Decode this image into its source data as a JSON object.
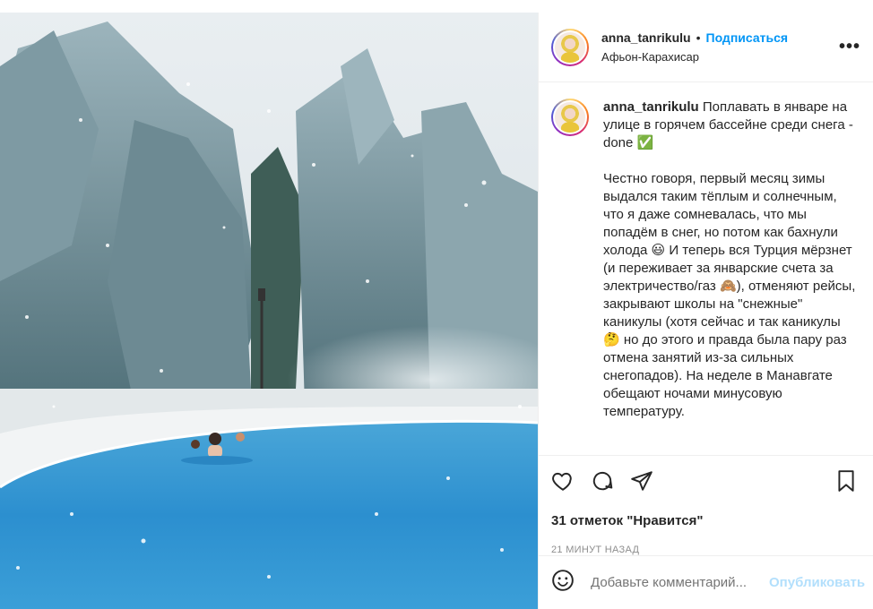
{
  "post": {
    "username": "anna_tanrikulu",
    "dot": "•",
    "follow_label": "Подписаться",
    "location": "Афьон-Карахисар",
    "more_label": "•••",
    "caption_username": "anna_tanrikulu",
    "caption_lines": [
      "Поплавать в январе на улице в горячем бассейне среди снега - done ✅",
      "Честно говоря, первый месяц зимы выдался таким тёплым и солнечным, что я даже сомневалась, что мы попадём в снег, но потом как бахнули холода 😃 И теперь вся Турция мёрзнет (и переживает за январские счета за электричество/газ 🙈), отменяют рейсы, закрывают школы на \"снежные\" каникулы (хотя сейчас и так каникулы 🤔 но до этого и правда была пару раз отмена занятий из-за сильных снегопадов). На неделе в Манавгате обещают ночами минусовую температуру."
    ],
    "likes": "31 отметок \"Нравится\"",
    "time": "21 МИНУТ НАЗАД",
    "comment_placeholder": "Добавьте комментарий...",
    "publish_label": "Опубликовать"
  },
  "icons": {
    "like": "heart-icon",
    "comment": "comment-icon",
    "share": "share-icon",
    "save": "bookmark-icon",
    "emoji": "smiley-icon"
  },
  "colors": {
    "link": "#0095f6",
    "publish_disabled": "#b2dffc",
    "muted": "#8e8e8e",
    "text": "#262626"
  }
}
